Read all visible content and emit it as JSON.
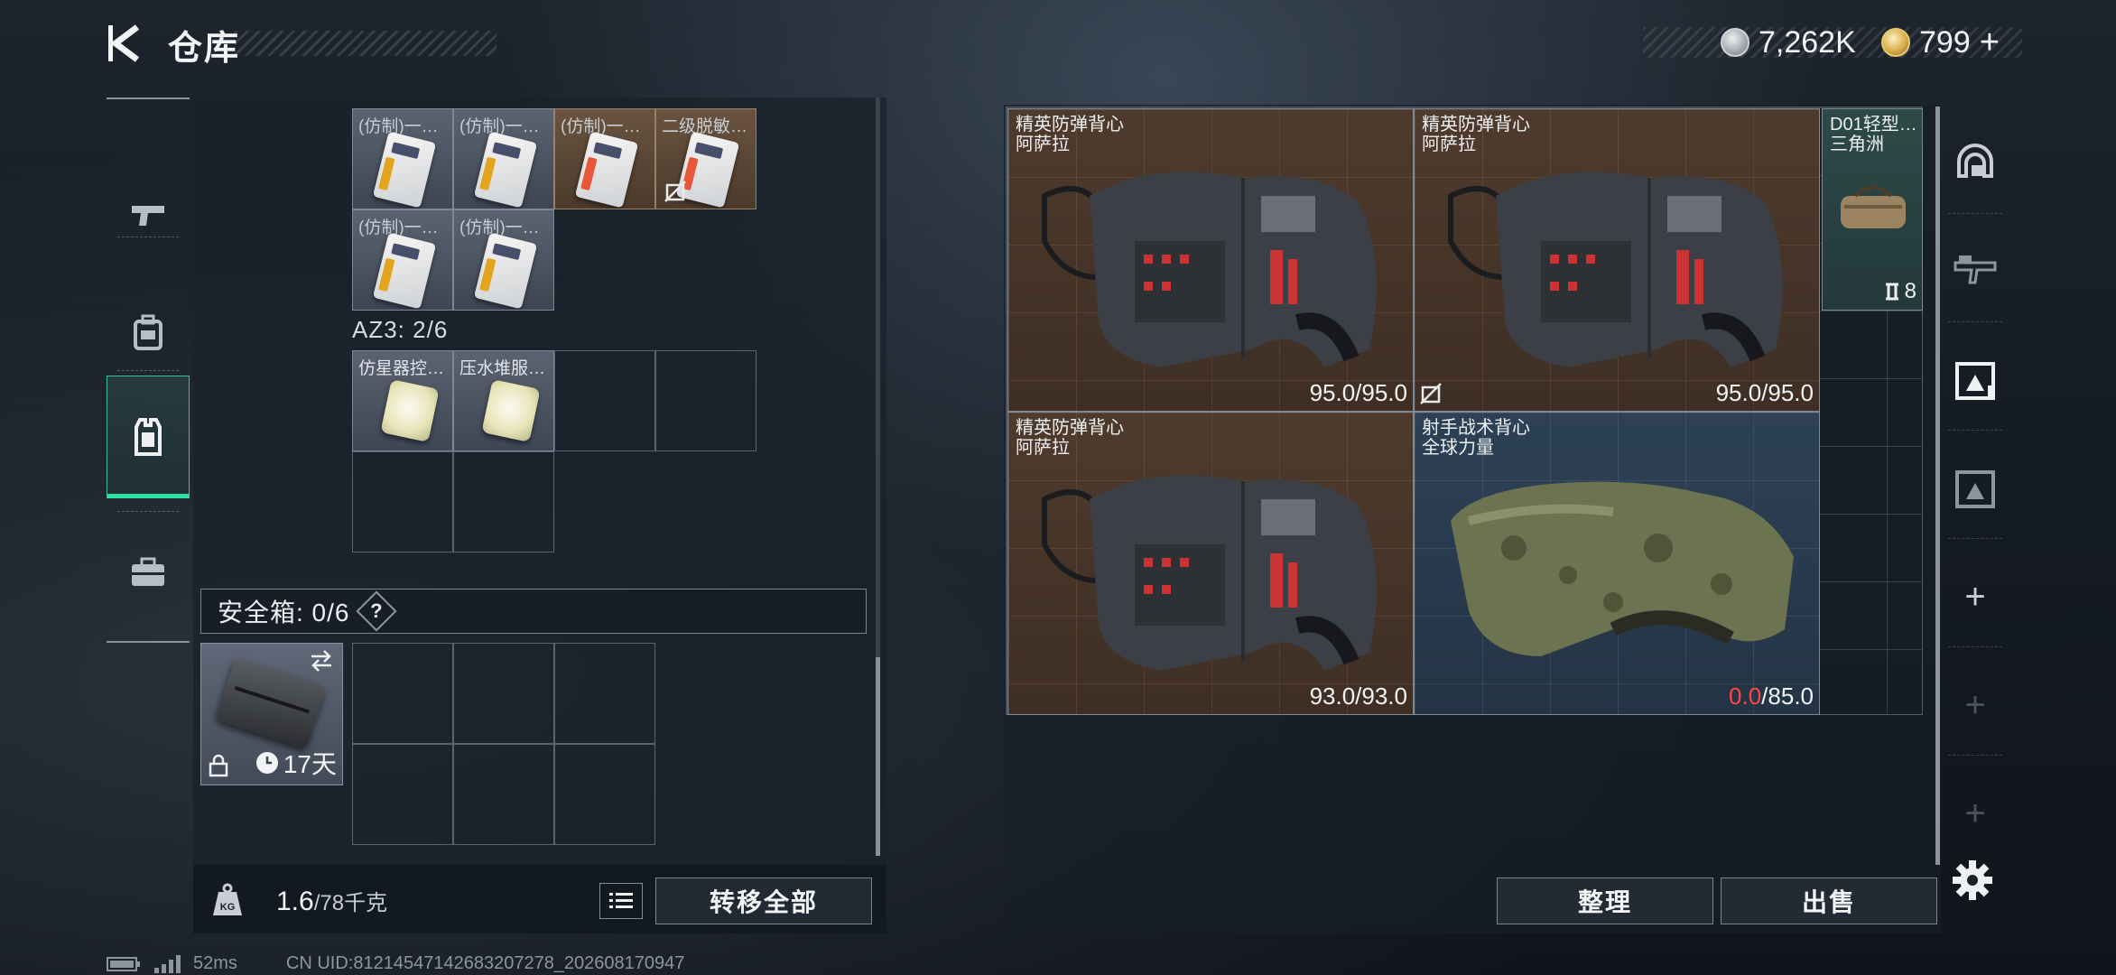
{
  "header": {
    "title": "仓库",
    "currency_silver": "7,262K",
    "currency_gold": "799",
    "add_label": "+"
  },
  "left_nav": [
    "gun-icon",
    "backpack-icon",
    "vest-icon",
    "briefcase-icon"
  ],
  "left_grid": {
    "items_top": [
      {
        "name": "(仿制)一…",
        "color": "gray",
        "icon": "keycard-icon"
      },
      {
        "name": "(仿制)一…",
        "color": "gray",
        "icon": "keycard-icon"
      },
      {
        "name": "(仿制)一…",
        "color": "orange",
        "icon": "keycard-icon"
      },
      {
        "name": "二级脱敏…",
        "color": "orange",
        "icon": "keycard-icon",
        "no_trade": true
      },
      {
        "name": "(仿制)一…",
        "color": "gray",
        "icon": "keycard-icon"
      },
      {
        "name": "(仿制)一…",
        "color": "gray",
        "icon": "keycard-icon"
      }
    ],
    "az3_label": "AZ3: 2/6",
    "items_az3": [
      {
        "name": "仿星器控…",
        "color": "gray",
        "icon": "disc-icon"
      },
      {
        "name": "压水堆服…",
        "color": "gray",
        "icon": "disc-icon"
      }
    ]
  },
  "safebox": {
    "label": "安全箱: 0/6",
    "help": "?",
    "days": "17天"
  },
  "weight": {
    "current": "1.6",
    "max": "/78千克"
  },
  "buttons": {
    "transfer_all": "转移全部",
    "sort": "整理",
    "sell": "出售"
  },
  "right_items": [
    {
      "name1": "精英防弹背心",
      "name2": "阿萨拉",
      "durability": "95.0/95.0",
      "color": "brown"
    },
    {
      "name1": "精英防弹背心",
      "name2": "阿萨拉",
      "durability": "95.0/95.0",
      "color": "brown"
    },
    {
      "name1": "D01轻型…",
      "name2": "三角洲",
      "count": "8",
      "color": "teal"
    },
    {
      "name1": "精英防弹背心",
      "name2": "阿萨拉",
      "durability": "93.0/93.0",
      "color": "brown"
    },
    {
      "name1": "射手战术背心",
      "name2": "全球力量",
      "durability_current": "0.0",
      "durability_max": "/85.0",
      "color": "blue"
    }
  ],
  "right_nav": [
    "helmet-icon",
    "rifle-icon",
    "vest-icon",
    "vest-icon",
    "+",
    "+",
    "+"
  ],
  "footer": {
    "ping": "52ms",
    "uid": "CN UID:8121454714268320727​8_202608170947"
  }
}
